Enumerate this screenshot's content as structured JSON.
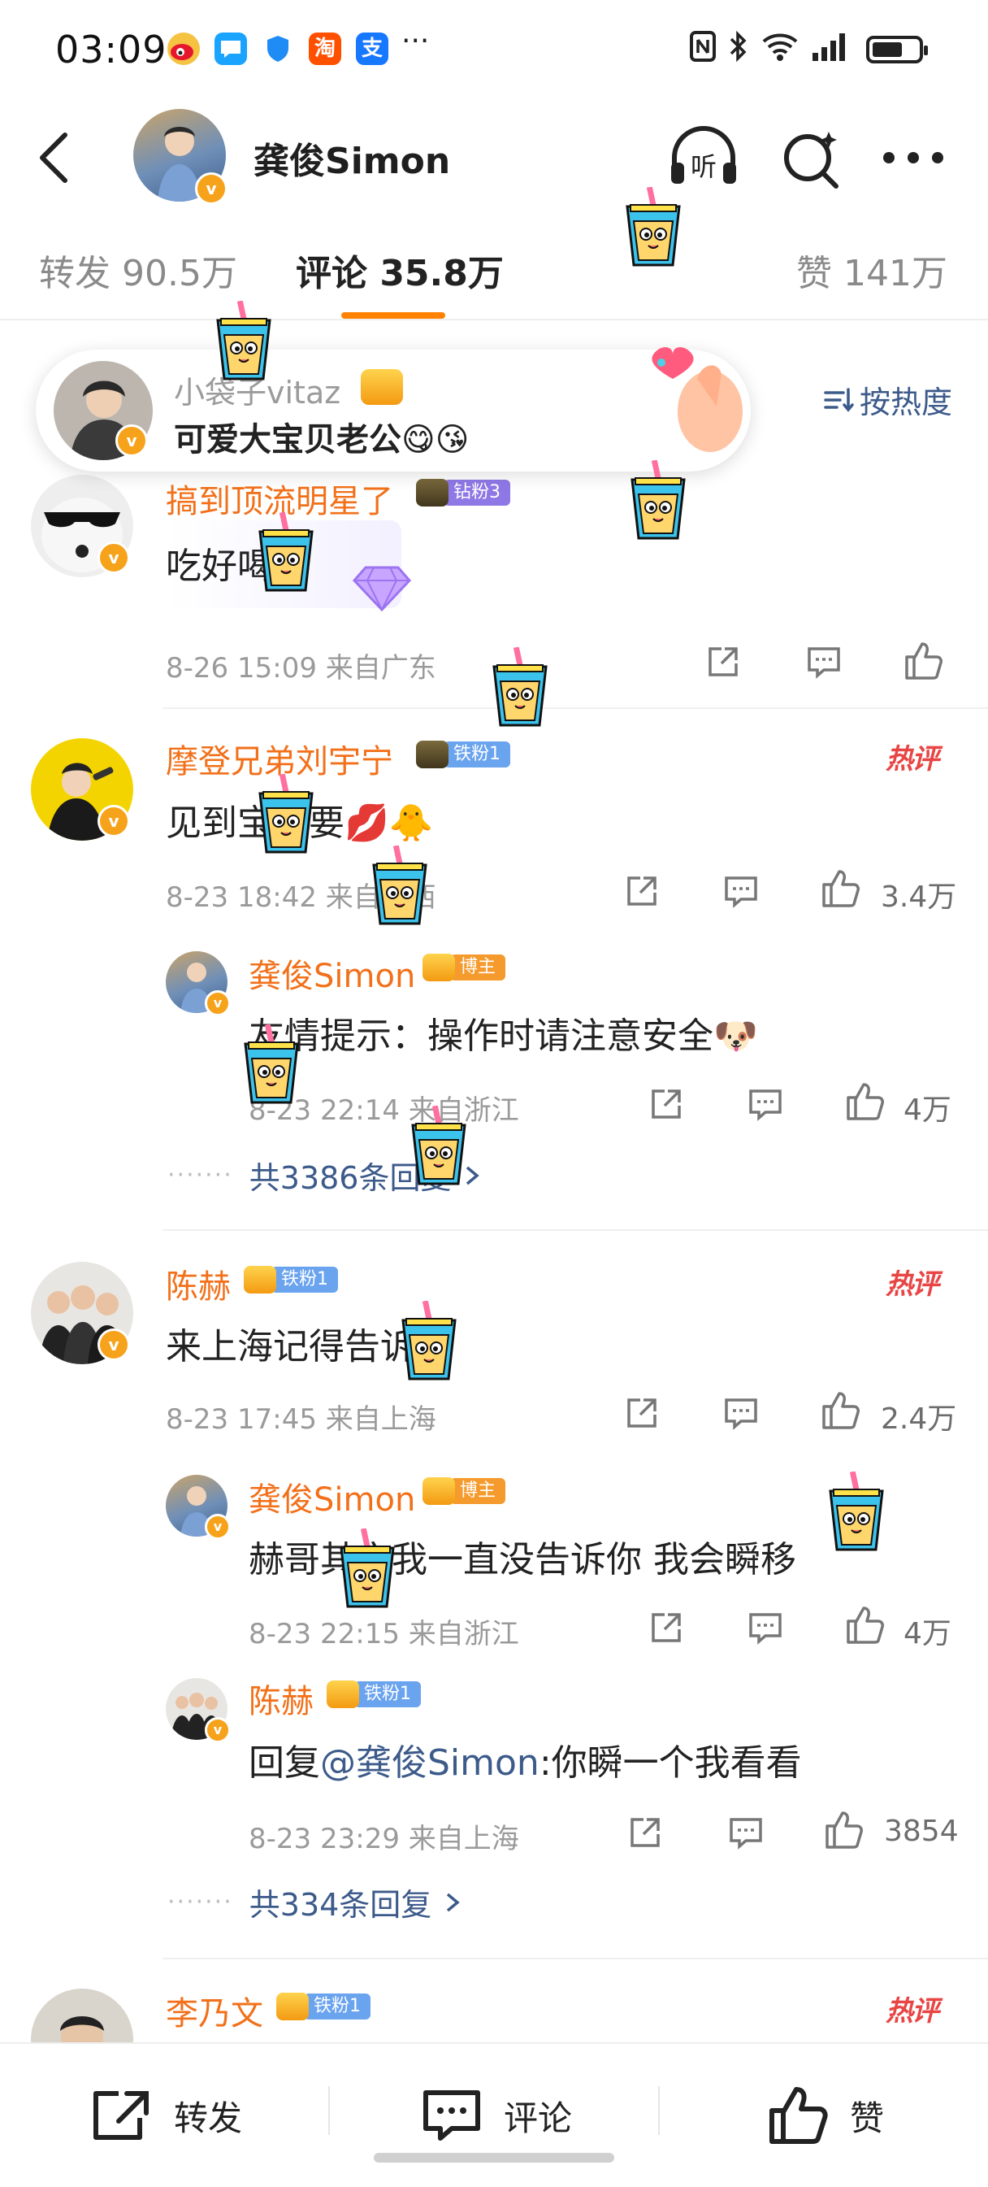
{
  "status_bar": {
    "time": "03:09",
    "apps": [
      "weibo-icon",
      "message-icon",
      "shield-icon",
      "taobao-icon",
      "alipay-icon"
    ],
    "taobao_glyph": "淘",
    "alipay_glyph": "支",
    "more": "···",
    "right_icons": [
      "nfc-icon",
      "bluetooth-icon",
      "wifi-icon",
      "signal-icon",
      "battery-icon"
    ]
  },
  "header": {
    "name": "龚俊Simon",
    "listen_label": "听"
  },
  "tabs": [
    {
      "label": "转发 90.5万",
      "active": false
    },
    {
      "label": "评论 35.8万",
      "active": true
    },
    {
      "label": "赞 141万",
      "active": false
    }
  ],
  "sort": {
    "label": "按热度"
  },
  "popup": {
    "user": "小袋子vitaz",
    "text": "可爱大宝贝老公😋😘"
  },
  "comments": [
    {
      "name": "搞到顶流明星了",
      "badge": "钻粉3",
      "text": "吃好喝好",
      "meta": "8-26 15:09  来自广东",
      "likes": ""
    },
    {
      "name": "摩登兄弟刘宇宁",
      "badge": "铁粉1",
      "hot": "热评",
      "text": "见到宝宝要💋🐥",
      "meta": "8-23 18:42  来自辽西",
      "likes": "3.4万",
      "replies": [
        {
          "name": "龚俊Simon",
          "badge": "博主",
          "text": "友情提示：操作时请注意安全🐶",
          "meta": "8-23 22:14  来自浙江",
          "likes": "4万"
        }
      ],
      "more_replies": "共3386条回复"
    },
    {
      "name": "陈赫",
      "badge": "铁粉1",
      "hot": "热评",
      "text": "来上海记得告诉我",
      "meta": "8-23 17:45  来自上海",
      "likes": "2.4万",
      "replies": [
        {
          "name": "龚俊Simon",
          "badge": "博主",
          "text": "赫哥其实我一直没告诉你 我会瞬移",
          "meta": "8-23 22:15  来自浙江",
          "likes": "4万"
        },
        {
          "name": "陈赫",
          "badge": "铁粉1",
          "reply_prefix": "回复",
          "mention": "@龚俊Simon",
          "text": ":你瞬一个我看看",
          "meta": "8-23 23:29  来自上海",
          "likes": "3854"
        }
      ],
      "more_replies": "共334条回复"
    },
    {
      "name": "李乃文",
      "badge": "铁粉1",
      "hot": "热评"
    }
  ],
  "bottom_bar": {
    "repost": "转发",
    "comment": "评论",
    "like": "赞"
  },
  "colors": {
    "accent_orange": "#ff8200",
    "username_orange": "#f2701a",
    "link_blue": "#3c5a8a",
    "hot_red": "#e84545"
  }
}
